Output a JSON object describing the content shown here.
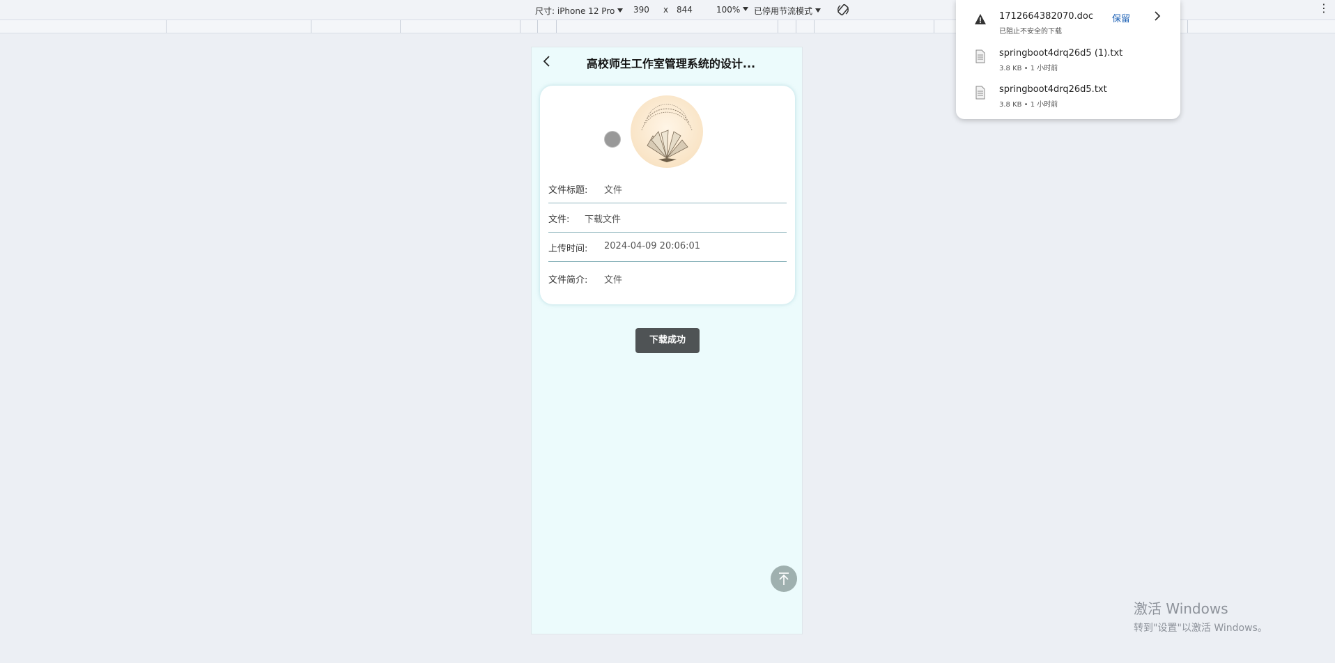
{
  "devtools": {
    "device_label": "尺寸: iPhone 12 Pro",
    "width": "390",
    "times": "x",
    "height": "844",
    "zoom": "100%",
    "throttle": "已停用节流模式"
  },
  "app": {
    "title": "高校师生工作室管理系统的设计...",
    "fields": [
      {
        "label": "文件标题:",
        "value": "文件"
      },
      {
        "label": "文件:",
        "value": "下载文件"
      },
      {
        "label": "上传时间:",
        "value": "2024-04-09 20:06:01"
      },
      {
        "label": "文件简介:",
        "value": "文件"
      }
    ],
    "toast": "下载成功"
  },
  "downloads": {
    "items": [
      {
        "name": "1712664382070.doc",
        "sub": "已阻止不安全的下载",
        "action": "保留",
        "icon": "warning-icon"
      },
      {
        "name": "springboot4drq26d5 (1).txt",
        "sub": "3.8 KB • 1 小时前",
        "icon": "file-icon"
      },
      {
        "name": "springboot4drq26d5.txt",
        "sub": "3.8 KB • 1 小时前",
        "icon": "file-icon"
      }
    ]
  },
  "watermark": {
    "line1": "激活 Windows",
    "line2": "转到\"设置\"以激活 Windows。"
  },
  "colors": {
    "page_bg": "#eceff4",
    "phone_bg": "#ecfbfc",
    "keep_link": "#1a5fb4",
    "toast_bg": "#4f5355",
    "divider": "#8fb6bd"
  }
}
